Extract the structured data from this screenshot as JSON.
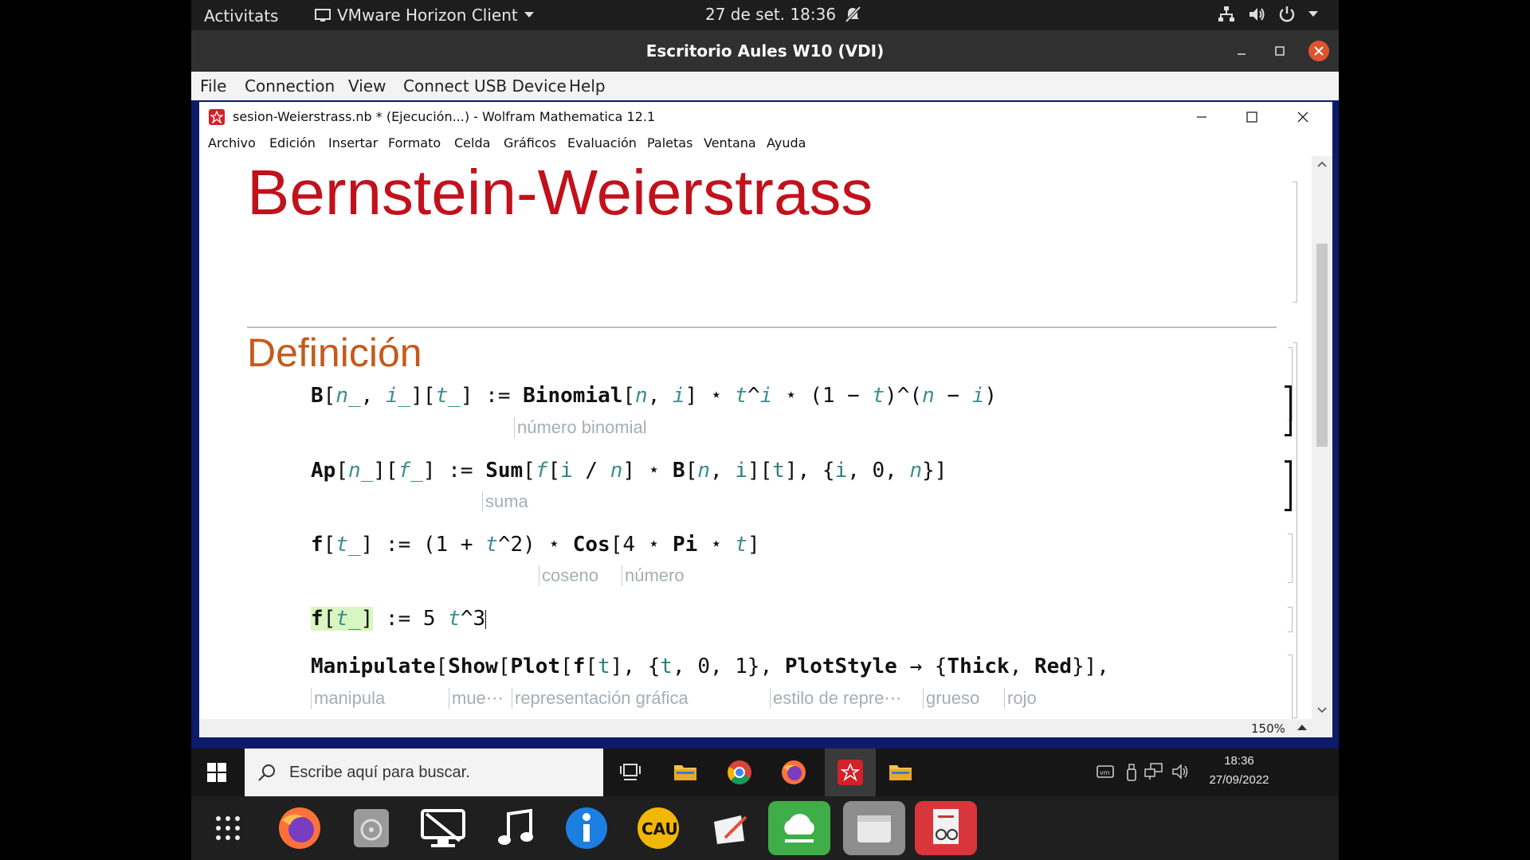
{
  "ubuntu_bar": {
    "activities": "Activitats",
    "app_name": "VMware Horizon Client",
    "datetime": "27 de set.  18:36"
  },
  "horizon": {
    "title": "Escritorio Aules W10 (VDI)",
    "menu": [
      "File",
      "Connection",
      "View",
      "Connect USB Device",
      "Help"
    ]
  },
  "mathematica": {
    "title": "sesion-Weierstrass.nb * (Ejecución...) - Wolfram Mathematica 12.1",
    "menu": [
      "Archivo",
      "Edición",
      "Insertar",
      "Formato",
      "Celda",
      "Gráficos",
      "Evaluación",
      "Paletas",
      "Ventana",
      "Ayuda"
    ],
    "notebook_title": "Bernstein-Weierstrass",
    "section": "Definición",
    "cells": [
      {
        "code": "B[n_, i_][t_] := Binomial[n, i] ⋆ t^i ⋆ (1 − t)^(n − i)",
        "hints": [
          "número binomial"
        ]
      },
      {
        "code": "Ap[n_][f_] := Sum[f[i / n] ⋆ B[n, i][t], {i, 0, n}]",
        "hints": [
          "suma"
        ]
      },
      {
        "code": "f[t_] := (1 + t^2) ⋆ Cos[4 ⋆ Pi ⋆ t]",
        "hints": [
          "coseno",
          "número"
        ]
      },
      {
        "code": "f[t_] := 5 t^3",
        "hints": []
      },
      {
        "code": "Manipulate[Show[Plot[f[t], {t, 0, 1}, PlotStyle → {Thick, Red}],",
        "hints": [
          "manipula",
          "mue⋯",
          "representación gráfica",
          "estilo de repre⋯",
          "grueso",
          "rojo"
        ]
      }
    ],
    "zoom": "150%"
  },
  "taskbar": {
    "search_placeholder": "Escribe aquí para buscar.",
    "time": "18:36",
    "date": "27/09/2022"
  },
  "colors": {
    "title_red": "#c1121c",
    "section_orange": "#c45a1c",
    "variable_teal": "#3a8f8f",
    "hint_gray": "#a5aeb6"
  }
}
